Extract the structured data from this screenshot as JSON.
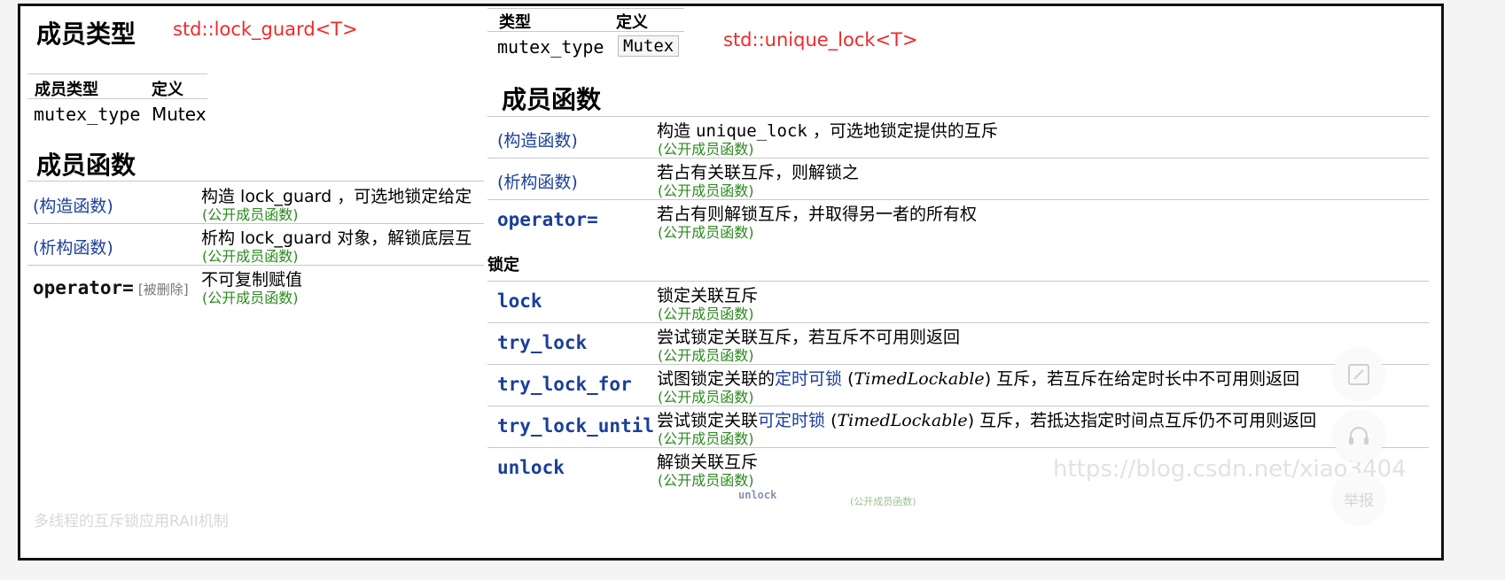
{
  "left": {
    "heading_types": "成员类型",
    "caption": "std::lock_guard<T>",
    "table_headers": [
      "成员类型",
      "定义"
    ],
    "table_row": [
      "mutex_type",
      "Mutex"
    ],
    "heading_functions": "成员函数",
    "functions": [
      {
        "name": "(构造函数)",
        "desc": "构造 lock_guard ，可选地锁定给定",
        "sub": "(公开成员函数)"
      },
      {
        "name": "(析构函数)",
        "desc": "析构 lock_guard 对象，解锁底层互",
        "sub": "(公开成员函数)"
      },
      {
        "name": "operator=",
        "deleted": "[被删除]",
        "desc": "不可复制赋值",
        "sub": "(公开成员函数)"
      }
    ]
  },
  "right": {
    "table_headers": [
      "类型",
      "定义"
    ],
    "table_row": [
      "mutex_type",
      "Mutex"
    ],
    "caption": "std::unique_lock<T>",
    "heading_functions": "成员函数",
    "functions": [
      {
        "name": "(构造函数)",
        "desc_pre": "构造 ",
        "desc_code": "unique_lock",
        "desc_post": " ，可选地锁定提供的互斥",
        "sub": "(公开成员函数)"
      },
      {
        "name": "(析构函数)",
        "desc": "若占有关联互斥，则解锁之",
        "sub": "(公开成员函数)"
      },
      {
        "name": "operator=",
        "desc": "若占有则解锁互斥，并取得另一者的所有权",
        "sub": "(公开成员函数)"
      }
    ],
    "section_lock": "锁定",
    "lock_functions": [
      {
        "name": "lock",
        "desc": "锁定关联互斥",
        "sub": "(公开成员函数)"
      },
      {
        "name": "try_lock",
        "desc": "尝试锁定关联互斥，若互斥不可用则返回",
        "sub": "(公开成员函数)"
      },
      {
        "name": "try_lock_for",
        "desc_pre": "试图锁定关联的",
        "link": "定时可锁",
        "ital": "TimedLockable",
        "desc_post": " 互斥，若互斥在给定时长中不可用则返回",
        "sub": "(公开成员函数)"
      },
      {
        "name": "try_lock_until",
        "desc_pre": "尝试锁定关联",
        "link": "可定时锁",
        "ital": "TimedLockable",
        "desc_post": " 互斥，若抵达指定时间点互斥仍不可用则返回",
        "sub": "(公开成员函数)"
      },
      {
        "name": "unlock",
        "desc": "解锁关联互斥",
        "sub": "(公开成员函数)"
      }
    ],
    "ghost_unlock": "unlock",
    "ghost_sub": "(公开成员函数)"
  },
  "watermark": "https://blog.csdn.net/xiao3404",
  "bottom_caption": "多线程的互斥锁应用RAII机制",
  "side": {
    "report_label": "举报",
    "icons": [
      "edit-icon",
      "headset-icon"
    ]
  }
}
